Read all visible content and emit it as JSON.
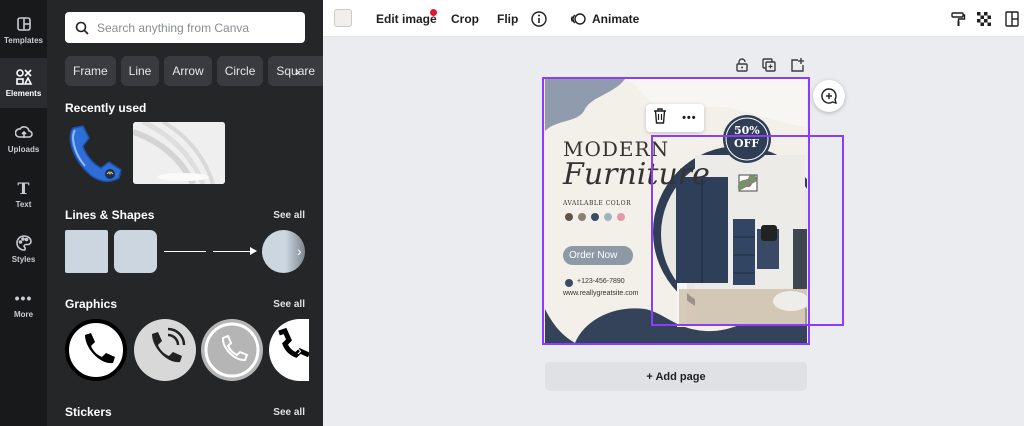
{
  "rail": {
    "items": [
      {
        "label": "Templates",
        "icon": "templates-icon"
      },
      {
        "label": "Elements",
        "icon": "elements-icon"
      },
      {
        "label": "Uploads",
        "icon": "uploads-icon"
      },
      {
        "label": "Text",
        "icon": "text-icon"
      },
      {
        "label": "Styles",
        "icon": "styles-icon"
      },
      {
        "label": "More",
        "icon": "more-icon"
      }
    ]
  },
  "panel": {
    "search_placeholder": "Search anything from Canva",
    "chips": [
      "Frame",
      "Line",
      "Arrow",
      "Circle",
      "Square"
    ],
    "recently_used": "Recently used",
    "lines_shapes": "Lines & Shapes",
    "graphics": "Graphics",
    "stickers": "Stickers",
    "see_all": "See all"
  },
  "toolbar": {
    "edit_image": "Edit image",
    "crop": "Crop",
    "flip": "Flip",
    "animate": "Animate"
  },
  "design": {
    "heading": "MODERN",
    "script": "Furniture",
    "available_color": "AVAILABLE COLOR",
    "badge_top": "50%",
    "badge_bottom": "OFF",
    "cta": "Order Now",
    "phone": "+123-456-7890",
    "website": "www.reallygreatsite.com",
    "swatches": [
      "#5e5548",
      "#8a8270",
      "#3c4a63",
      "#9fb4be",
      "#e29aa6"
    ]
  },
  "canvas": {
    "add_page": "+ Add page"
  },
  "colors": {
    "accent": "#8b3dff",
    "navy": "#2f3e55"
  }
}
